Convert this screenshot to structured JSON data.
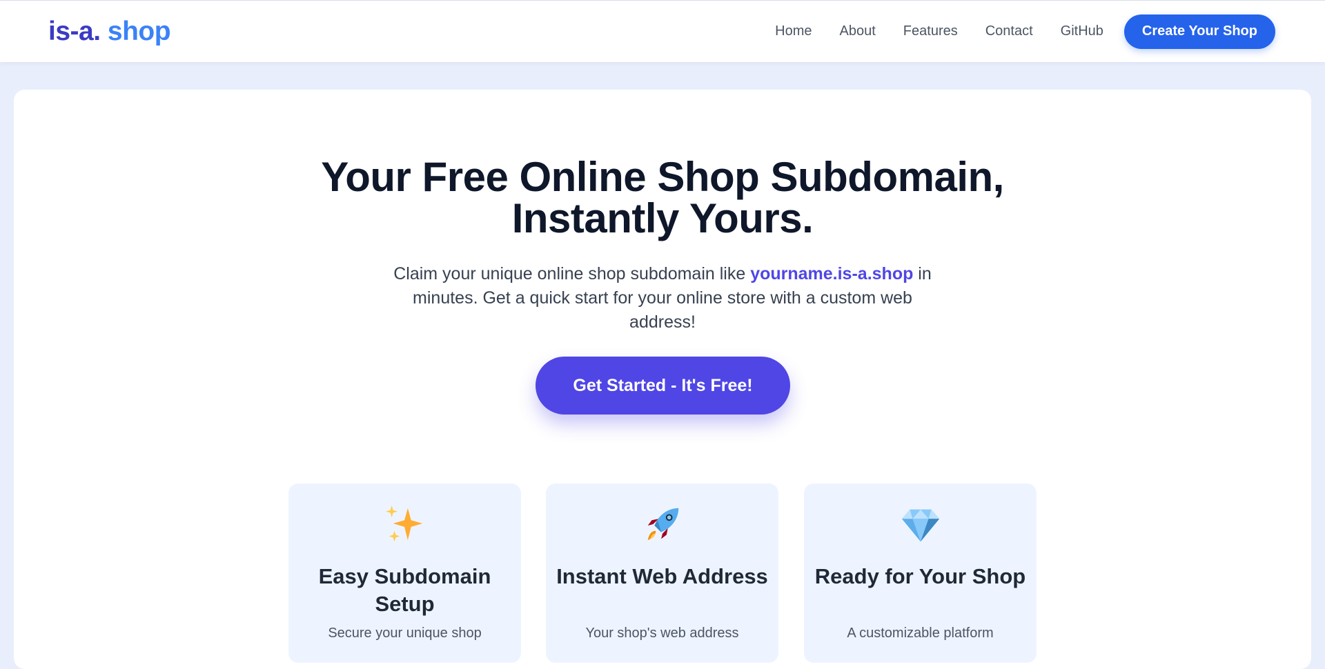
{
  "header": {
    "logo_part1": "is-a.",
    "logo_part2": " shop",
    "nav": [
      "Home",
      "About",
      "Features",
      "Contact",
      "GitHub"
    ],
    "cta_label": "Create Your Shop"
  },
  "hero": {
    "title_line1": "Your Free Online Shop Subdomain,",
    "title_line2": "Instantly Yours.",
    "subtitle_before": "Claim your unique online shop subdomain like ",
    "subtitle_highlight": "yourname.is-a.shop",
    "subtitle_after": " in minutes. Get a quick start for your online store with a custom web address!",
    "button_label": "Get Started - It's Free!"
  },
  "features": [
    {
      "icon": "sparkles-icon",
      "title": "Easy Subdomain Setup",
      "text": "Secure your unique shop"
    },
    {
      "icon": "rocket-icon",
      "title": "Instant Web Address",
      "text": "Your shop's web address"
    },
    {
      "icon": "gem-icon",
      "title": "Ready for Your Shop",
      "text": "A customizable platform"
    }
  ],
  "colors": {
    "primary": "#4f46e5",
    "nav_cta": "#2563eb",
    "page_bg": "#e8eefc",
    "feature_bg": "#eef4ff"
  }
}
